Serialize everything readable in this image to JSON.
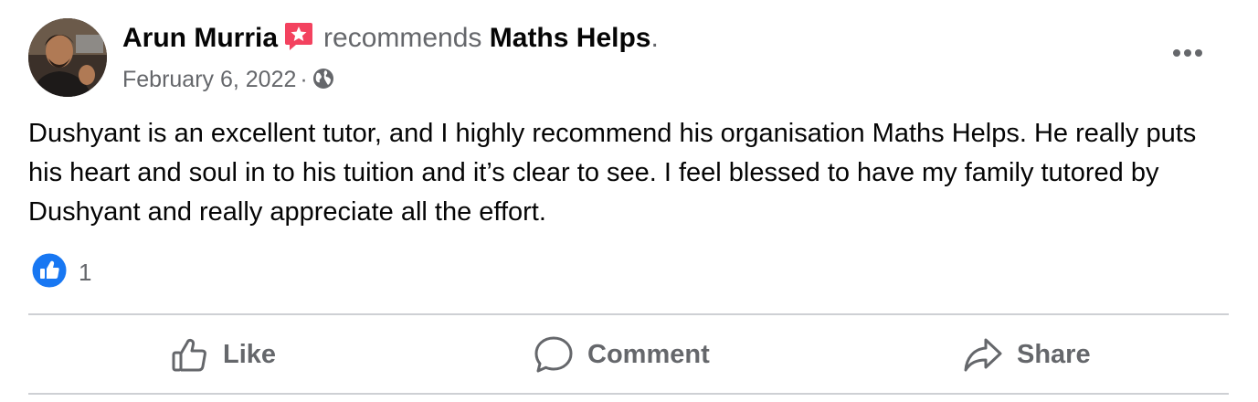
{
  "post": {
    "author_name": "Arun Murria",
    "verb": "recommends",
    "page_name": "Maths Helps",
    "period": ".",
    "date": "February 6, 2022",
    "separator": "·",
    "text": "Dushyant is an excellent tutor, and I highly recommend his organisation Maths Helps. He really puts his heart and soul in to his tuition and it’s clear to see. I feel blessed to have my family tutored by Dushyant and really appreciate all the effort.",
    "reaction_count": "1"
  },
  "icons": {
    "badge": "recommend-star-icon",
    "privacy": "globe-icon",
    "more": "more-options-icon",
    "reaction": "like-reaction-icon"
  },
  "actions": {
    "like_label": "Like",
    "comment_label": "Comment",
    "share_label": "Share"
  },
  "colors": {
    "primary_text": "#050505",
    "secondary_text": "#65676b",
    "like_blue": "#1877f2",
    "badge_red": "#f3425f",
    "divider": "#ced0d4"
  }
}
